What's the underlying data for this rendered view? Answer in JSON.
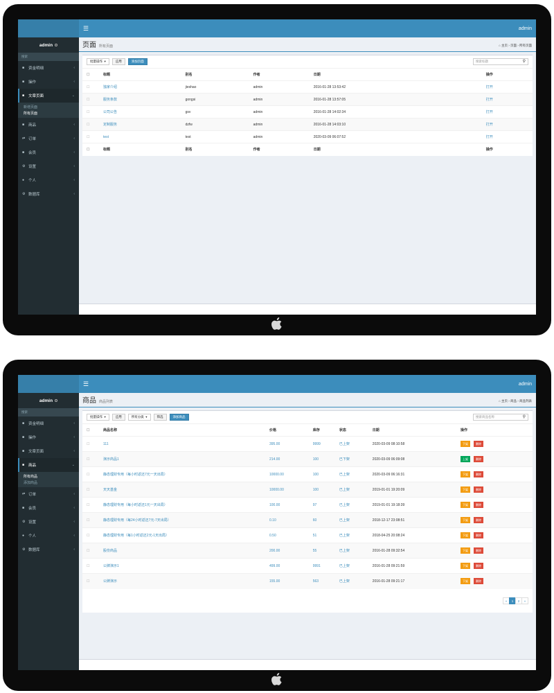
{
  "admin": "admin",
  "sidebar": {
    "search_placeholder": "搜索",
    "items": [
      "资金明细",
      "操作",
      "文章页面",
      "商品",
      "订单",
      "会员",
      "设置",
      "个人",
      "数据库"
    ]
  },
  "s1": {
    "title": "页面",
    "subtitle": "所有页面",
    "breadcrumb": [
      "主页",
      "页面",
      "所有页面"
    ],
    "sub_items": [
      "新增页面",
      "所有页面"
    ],
    "bulk": "批量操作",
    "apply": "应用",
    "add": "添加页面",
    "search": "搜索标题",
    "cols": [
      "标题",
      "别名",
      "作者",
      "日期",
      "操作"
    ],
    "rows": [
      {
        "title": "独家介绍",
        "alias": "jieshao",
        "author": "admin",
        "date": "2016-01-28 13:53:42",
        "op": "打开"
      },
      {
        "title": "服务条款",
        "alias": "gongsi",
        "author": "admin",
        "date": "2016-01-28 13:57:05",
        "op": "打开"
      },
      {
        "title": "公司公告",
        "alias": "gsv",
        "author": "admin",
        "date": "2016-01-28 14:02:34",
        "op": "打开"
      },
      {
        "title": "定制服务",
        "alias": "dzfw",
        "author": "admin",
        "date": "2016-01-28 14:03:10",
        "op": "打开"
      },
      {
        "title": "test",
        "alias": "test",
        "author": "admin",
        "date": "2020-03-09 06:07:52",
        "op": "打开"
      }
    ]
  },
  "s2": {
    "title": "商品",
    "subtitle": "商品列表",
    "breadcrumb": [
      "主页",
      "商品",
      "商品列表"
    ],
    "sub_items": [
      "所有商品",
      "添加商品"
    ],
    "bulk": "批量操作",
    "apply": "应用",
    "filter": "所有分类",
    "filter_btn": "筛选",
    "add": "添加商品",
    "search": "搜索商品名称",
    "cols": [
      "商品名称",
      "价格",
      "库存",
      "状态",
      "日期",
      "操作"
    ],
    "rows": [
      {
        "name": "111",
        "price": "395.00",
        "stock": "9999",
        "status": "已上架",
        "date": "2020-03-09 08:10:58",
        "btn": "下架",
        "type": "warn"
      },
      {
        "name": "演示商品1",
        "price": "214.00",
        "stock": "100",
        "status": "已下架",
        "date": "2020-03-09 06:09:08",
        "btn": "上架",
        "type": "ok"
      },
      {
        "name": "静态理财专用（每小时返还7元一天出局）",
        "price": "10000.00",
        "stock": "100",
        "status": "已上架",
        "date": "2020-03-09 06:16:31",
        "btn": "下架",
        "type": "warn"
      },
      {
        "name": "天天基金",
        "price": "10000.00",
        "stock": "100",
        "status": "已上架",
        "date": "2019-01-01 19:20:09",
        "btn": "下架",
        "type": "warn"
      },
      {
        "name": "静态理财专用（每小时返还1元一天出局）",
        "price": "100.00",
        "stock": "97",
        "status": "已上架",
        "date": "2019-01-01 19:18:39",
        "btn": "下架",
        "type": "warn"
      },
      {
        "name": "静态理财专用（每24小时返还7元-7天出局）",
        "price": "0.10",
        "stock": "60",
        "status": "已上架",
        "date": "2018-12-17 23:08:51",
        "btn": "下架",
        "type": "warn"
      },
      {
        "name": "静态理财专用（每1小时返还2元-1天出局）",
        "price": "0.50",
        "stock": "51",
        "status": "已上架",
        "date": "2018-04-25 20:08:24",
        "btn": "下架",
        "type": "warn"
      },
      {
        "name": "股份商品",
        "price": "200.00",
        "stock": "55",
        "status": "已上架",
        "date": "2016-01-28 09:32:54",
        "btn": "下架",
        "type": "warn"
      },
      {
        "name": "公牌演示1",
        "price": "499.00",
        "stock": "9991",
        "status": "已上架",
        "date": "2016-01-28 09:21:59",
        "btn": "下架",
        "type": "warn"
      },
      {
        "name": "公牌演示",
        "price": "155.00",
        "stock": "563",
        "status": "已上架",
        "date": "2016-01-28 09:21:17",
        "btn": "下架",
        "type": "warn"
      }
    ],
    "delete": "删除",
    "pages": [
      "«",
      "1",
      "2",
      "»"
    ]
  }
}
